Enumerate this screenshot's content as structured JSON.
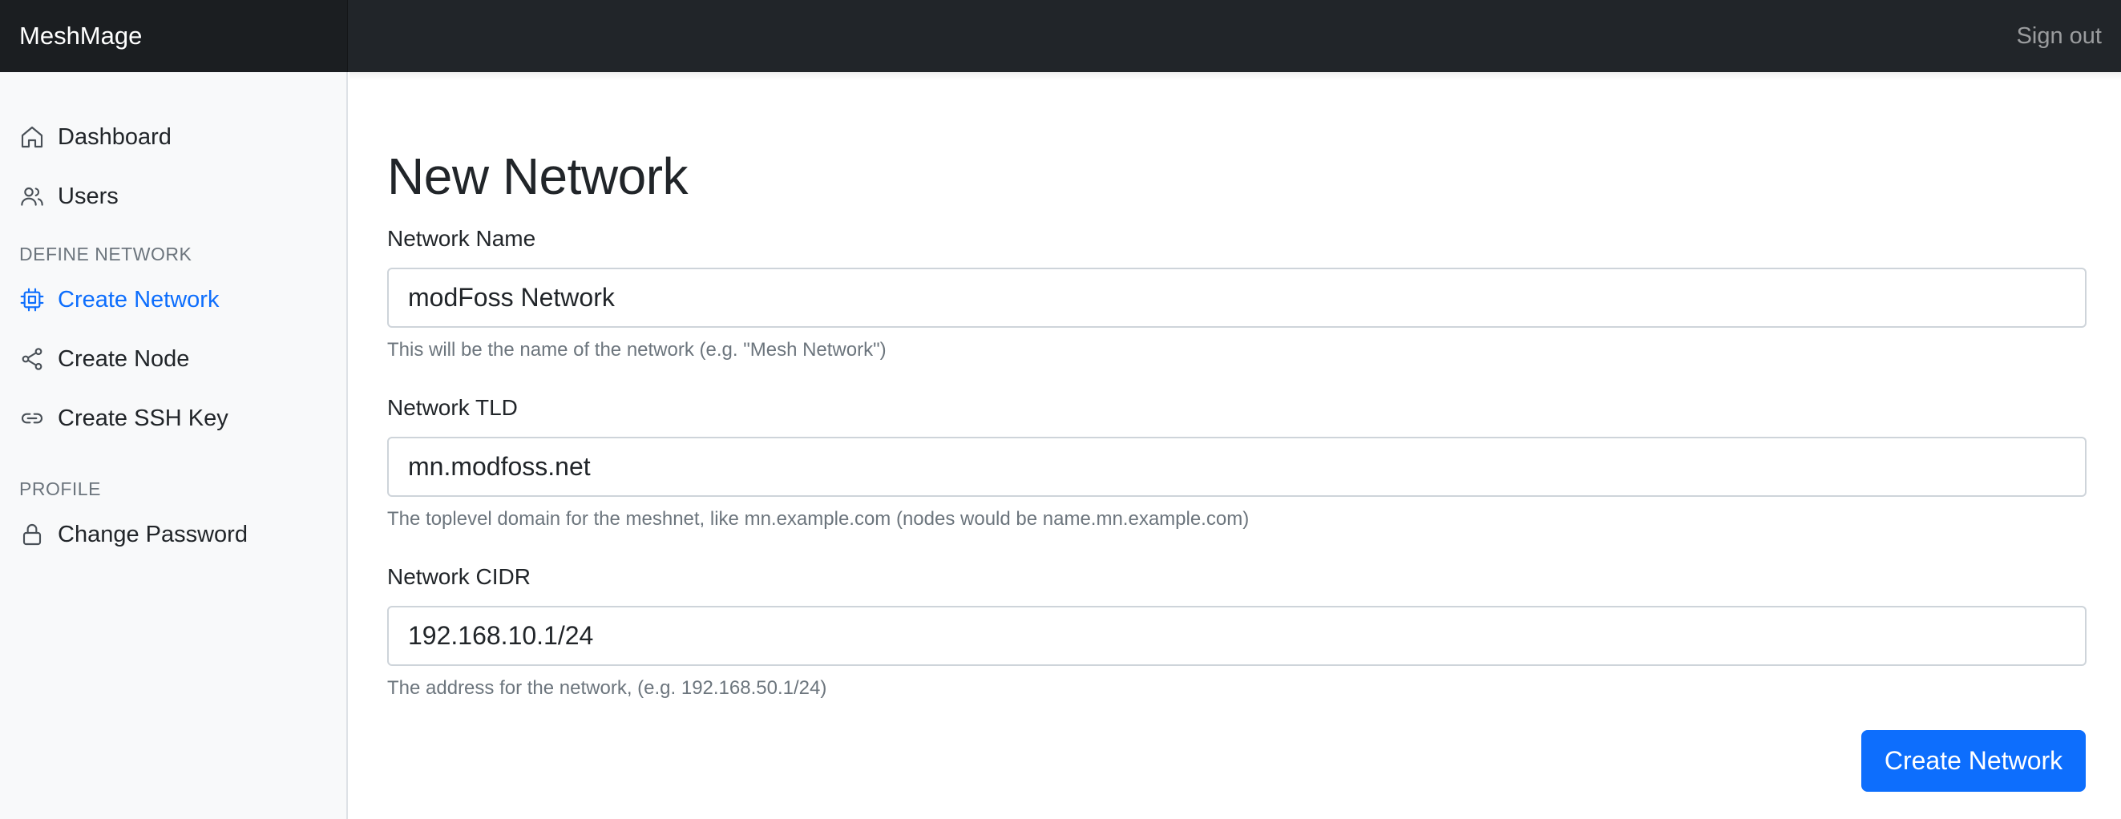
{
  "navbar": {
    "brand": "MeshMage",
    "sign_out": "Sign out"
  },
  "sidebar": {
    "items": [
      {
        "label": "Dashboard",
        "icon": "home-icon"
      },
      {
        "label": "Users",
        "icon": "users-icon"
      }
    ],
    "define_network": {
      "heading": "DEFINE NETWORK",
      "items": [
        {
          "label": "Create Network",
          "icon": "cpu-icon",
          "active": true
        },
        {
          "label": "Create Node",
          "icon": "share-icon"
        },
        {
          "label": "Create SSH Key",
          "icon": "link-icon"
        }
      ]
    },
    "profile": {
      "heading": "PROFILE",
      "items": [
        {
          "label": "Change Password",
          "icon": "lock-icon"
        }
      ]
    }
  },
  "main": {
    "title": "New Network",
    "fields": [
      {
        "label": "Network Name",
        "value": "modFoss Network",
        "help": "This will be the name of the network (e.g. \"Mesh Network\")"
      },
      {
        "label": "Network TLD",
        "value": "mn.modfoss.net",
        "help": "The toplevel domain for the meshnet, like mn.example.com (nodes would be name.mn.example.com)"
      },
      {
        "label": "Network CIDR",
        "value": "192.168.10.1/24",
        "help": "The address for the network, (e.g. 192.168.50.1/24)"
      }
    ],
    "submit_label": "Create Network"
  },
  "colors": {
    "navbar_bg": "#212529",
    "accent": "#0d6efd",
    "sidebar_bg": "#f8f9fa"
  }
}
